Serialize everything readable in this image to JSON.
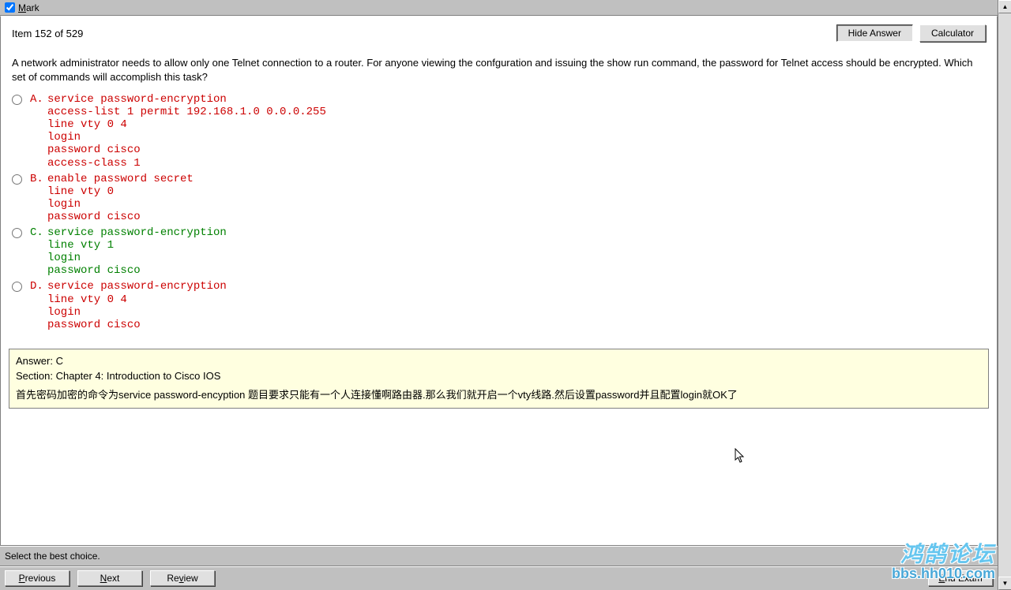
{
  "topbar": {
    "mark_label": "Mark",
    "mark_checked": true
  },
  "header": {
    "item_counter": "Item 152 of 529",
    "hide_answer_label": "Hide Answer",
    "calculator_label": "Calculator"
  },
  "question_text": "A network administrator needs to allow only one Telnet connection to a router. For anyone viewing the confguration and issuing the show run command, the password for Telnet access should be encrypted. Which set of commands will accomplish this task?",
  "options": [
    {
      "letter": "A.",
      "color": "red",
      "text": "service password-encryption\naccess-list 1 permit 192.168.1.0 0.0.0.255\nline vty 0 4\nlogin\npassword cisco\naccess-class 1"
    },
    {
      "letter": "B.",
      "color": "red",
      "text": "enable password secret\nline vty 0\nlogin\npassword cisco"
    },
    {
      "letter": "C.",
      "color": "green",
      "text": "service password-encryption\nline vty 1\nlogin\npassword cisco"
    },
    {
      "letter": "D.",
      "color": "red",
      "text": "service password-encryption\nline vty 0 4\nlogin\npassword cisco"
    }
  ],
  "answer_box": {
    "line1": "Answer: C",
    "line2": "Section: Chapter 4: Introduction to Cisco IOS",
    "explanation": "首先密码加密的命令为service password-encyption 题目要求只能有一个人连接懂啊路由器.那么我们就开启一个vty线路.然后设置password并且配置login就OK了"
  },
  "instruction": "Select the best choice.",
  "bottom": {
    "previous": "Previous",
    "next": "Next",
    "review": "Review",
    "end_exam": "End Exam"
  },
  "watermark": {
    "cn": "鸿鹄论坛",
    "url": "bbs.hh010.com"
  }
}
